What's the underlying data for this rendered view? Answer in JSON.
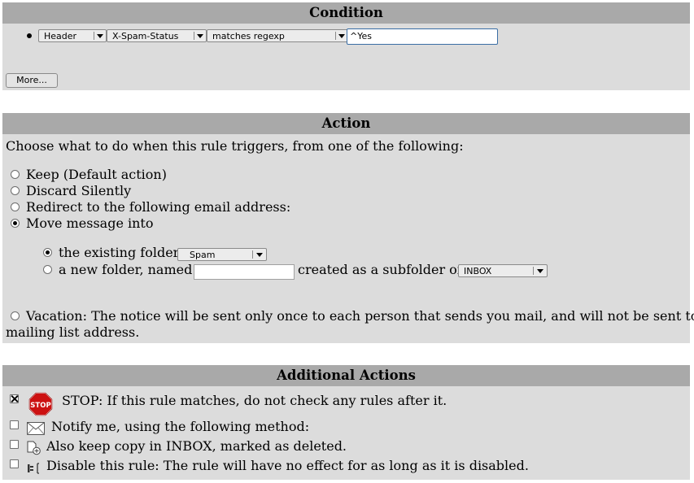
{
  "condition": {
    "title": "Condition",
    "field_type": "Header",
    "header_name": "X-Spam-Status",
    "match_type": "matches regexp",
    "value": "^Yes",
    "more_button": "More..."
  },
  "action": {
    "title": "Action",
    "intro": "Choose what to do when this rule triggers, from one of the following:",
    "options": {
      "keep": "Keep (Default action)",
      "discard": "Discard Silently",
      "redirect": "Redirect to the following email address:",
      "move": "Move message into"
    },
    "existing_folder_label": "the existing folder",
    "existing_folder_value": "Spam",
    "new_folder_label": "a new folder, named",
    "new_folder_value": "",
    "subfolder_label": "created as a subfolder of",
    "parent_folder_value": "INBOX",
    "vacation_text": "Vacation: The notice will be sent only once to each person that sends you mail, and will not be sent to a",
    "vacation_text_cont": "mailing list address.",
    "selected": "move"
  },
  "additional": {
    "title": "Additional Actions",
    "stop_label": "STOP: If this rule matches, do not check any rules after it.",
    "stop_icon_text": "STOP",
    "notify_label": "Notify me, using the following method:",
    "keep_copy_label": "Also keep copy in INBOX, marked as deleted.",
    "disable_label": "Disable this rule: The rule will have no effect for as long as it is disabled."
  }
}
